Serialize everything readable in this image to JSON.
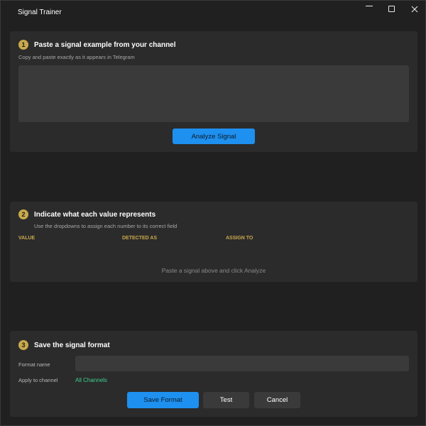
{
  "window": {
    "title": "Signal Trainer",
    "controls": {
      "minimize_icon": "minimize-icon",
      "maximize_icon": "maximize-icon",
      "close_icon": "close-icon"
    }
  },
  "step1": {
    "number": "1",
    "title": "Paste a signal example from your channel",
    "subtitle": "Copy and paste exactly as it appears in Telegram",
    "signal_text": "",
    "analyze_label": "Analyze Signal"
  },
  "step2": {
    "number": "2",
    "title": "Indicate what each value represents",
    "subtitle": "Use the dropdowns to assign each number to its correct field",
    "columns": [
      "VALUE",
      "DETECTED AS",
      "ASSIGN TO"
    ],
    "empty_message": "Paste a signal above and click Analyze"
  },
  "step3": {
    "number": "3",
    "title": "Save the signal format",
    "format_name_label": "Format name",
    "format_name_value": "",
    "apply_label": "Apply to channel",
    "apply_value": "All Channels",
    "save_label": "Save Format",
    "test_label": "Test",
    "cancel_label": "Cancel"
  },
  "colors": {
    "accent": "#1e90f0",
    "step_badge": "#c9a94c",
    "link": "#3ecf8e",
    "panel": "#2b2b2b",
    "background": "#202020"
  }
}
